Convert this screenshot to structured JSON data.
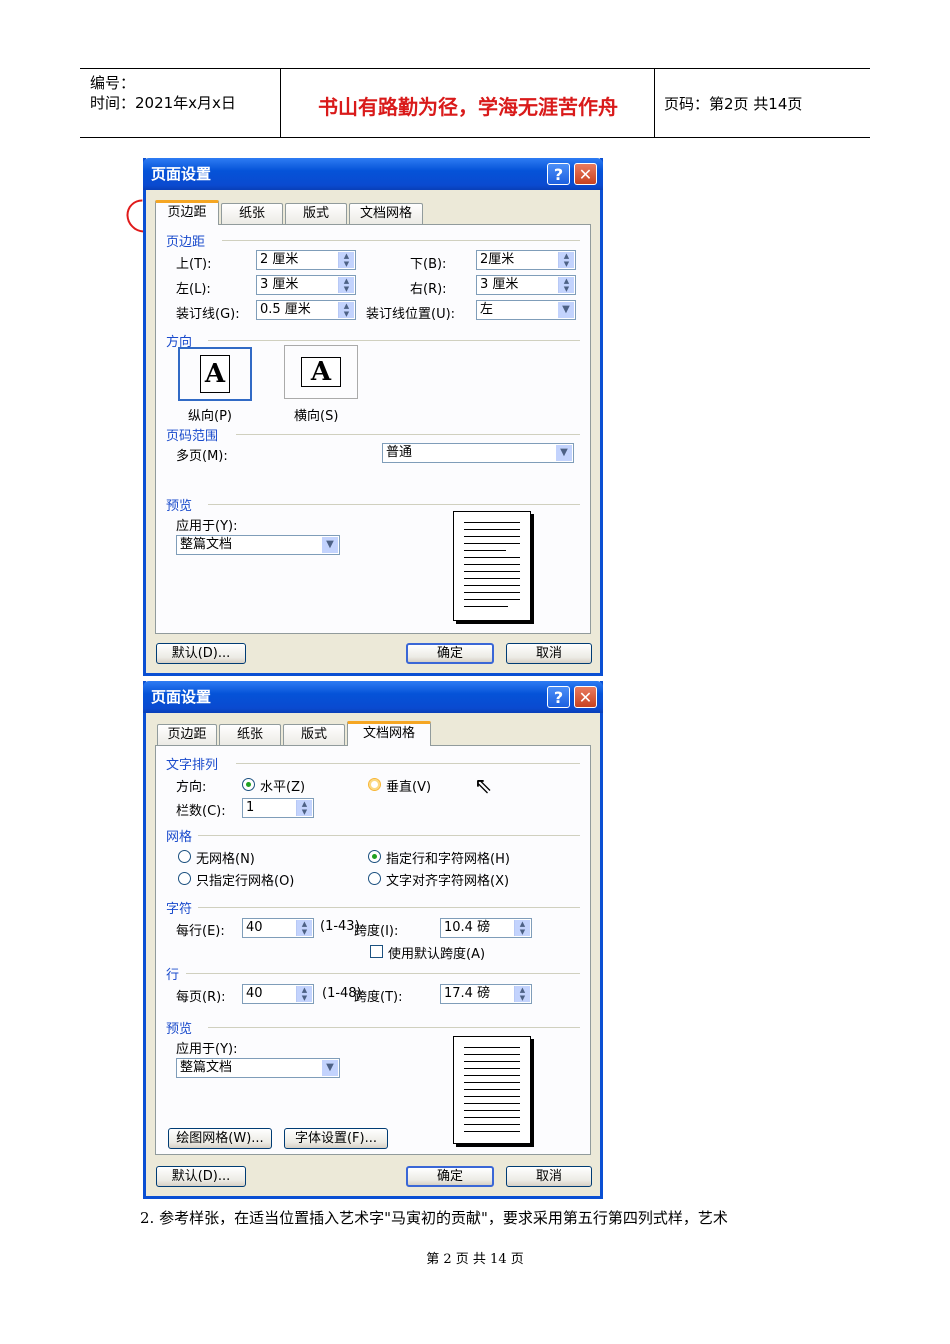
{
  "header": {
    "code_label": "编号：",
    "time_label": "时间：2021年x月x日",
    "motto": "书山有路勤为径，学海无涯苦作舟",
    "page_number": "页码：第2页  共14页"
  },
  "dialog1": {
    "title": "页面设置",
    "help_glyph": "?",
    "close_glyph": "✕",
    "tabs": [
      "页边距",
      "纸张",
      "版式",
      "文档网格"
    ],
    "active_tab": "页边距",
    "margins_section": "页边距",
    "top_label": "上(T):",
    "top_value": "2 厘米",
    "bottom_label": "下(B):",
    "bottom_value": "2厘米",
    "left_label": "左(L):",
    "left_value": "3 厘米",
    "right_label": "右(R):",
    "right_value": "3 厘米",
    "gutter_label": "装订线(G):",
    "gutter_value": "0.5 厘米",
    "gutter_pos_label": "装订线位置(U):",
    "gutter_pos_value": "左",
    "orientation_section": "方向",
    "portrait_label": "纵向(P)",
    "landscape_label": "横向(S)",
    "orientation_glyph": "A",
    "pages_section": "页码范围",
    "multi_pages_label": "多页(M):",
    "multi_pages_value": "普通",
    "preview_section": "预览",
    "apply_to_label": "应用于(Y):",
    "apply_to_value": "整篇文档",
    "default_button": "默认(D)...",
    "ok_button": "确定",
    "cancel_button": "取消"
  },
  "dialog2": {
    "title": "页面设置",
    "help_glyph": "?",
    "close_glyph": "✕",
    "tabs": [
      "页边距",
      "纸张",
      "版式",
      "文档网格"
    ],
    "active_tab": "文档网格",
    "text_dir_section": "文字排列",
    "direction_label": "方向:",
    "horizontal_label": "水平(Z)",
    "vertical_label": "垂直(V)",
    "columns_label": "栏数(C):",
    "columns_value": "1",
    "grid_section": "网格",
    "no_grid_label": "无网格(N)",
    "line_char_grid_label": "指定行和字符网格(H)",
    "line_grid_label": "只指定行网格(O)",
    "text_snap_label": "文字对齐字符网格(X)",
    "chars_section": "字符",
    "per_line_label": "每行(E):",
    "per_line_value": "40",
    "per_line_range": "(1-43)",
    "char_pitch_label": "跨度(I):",
    "char_pitch_value": "10.4 磅",
    "default_pitch_label": "使用默认跨度(A)",
    "lines_section": "行",
    "per_page_label": "每页(R):",
    "per_page_value": "40",
    "per_page_range": "(1-48)",
    "line_pitch_label": "跨度(T):",
    "line_pitch_value": "17.4 磅",
    "preview_section": "预览",
    "apply_to_label": "应用于(Y):",
    "apply_to_value": "整篇文档",
    "drawing_grid_button": "绘图网格(W)...",
    "font_settings_button": "字体设置(F)...",
    "default_button": "默认(D)...",
    "ok_button": "确定",
    "cancel_button": "取消"
  },
  "caption": "2. 参考样张，在适当位置插入艺术字\"马寅初的贡献\"，要求采用第五行第四列式样，艺术",
  "footer": "第 2 页 共 14 页"
}
